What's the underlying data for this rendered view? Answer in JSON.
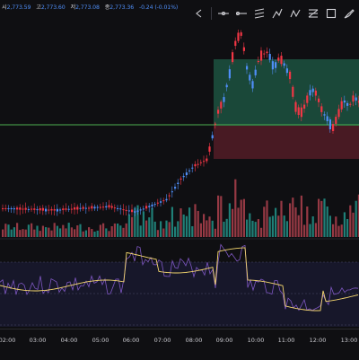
{
  "ohlc": [
    {
      "k": "시",
      "v": "2,773.59"
    },
    {
      "k": "고",
      "v": "2,773.60"
    },
    {
      "k": "저",
      "v": "2,773.08"
    },
    {
      "k": "종",
      "v": "2,773.36"
    }
  ],
  "change": "-0.24 (-0.01%)",
  "toolbar": [
    "arrow-back-icon",
    "horizontal-line-icon",
    "ray-icon",
    "parallel-channel-icon",
    "pitchfork-icon",
    "zigzag-icon",
    "fib-retracement-icon",
    "rectangle-icon",
    "brush-icon"
  ],
  "time_labels": [
    "02:00",
    "03:00",
    "04:00",
    "05:00",
    "06:00",
    "07:00",
    "08:00",
    "09:00",
    "10:00",
    "11:00",
    "12:00",
    "13:00"
  ],
  "colors": {
    "background": "#0f0f12",
    "up": "#4f8ef7",
    "down": "#f23645",
    "volume_up": "#26a69a",
    "volume_down": "#c44856",
    "horizontal_line": "#4caf50",
    "target_zone": "#1e5a45",
    "stop_zone": "#5a1e28",
    "rsi_line": "#7e57c2",
    "rsi_ma": "#f5d76e",
    "rsi_band": "#1a1a2e"
  }
}
